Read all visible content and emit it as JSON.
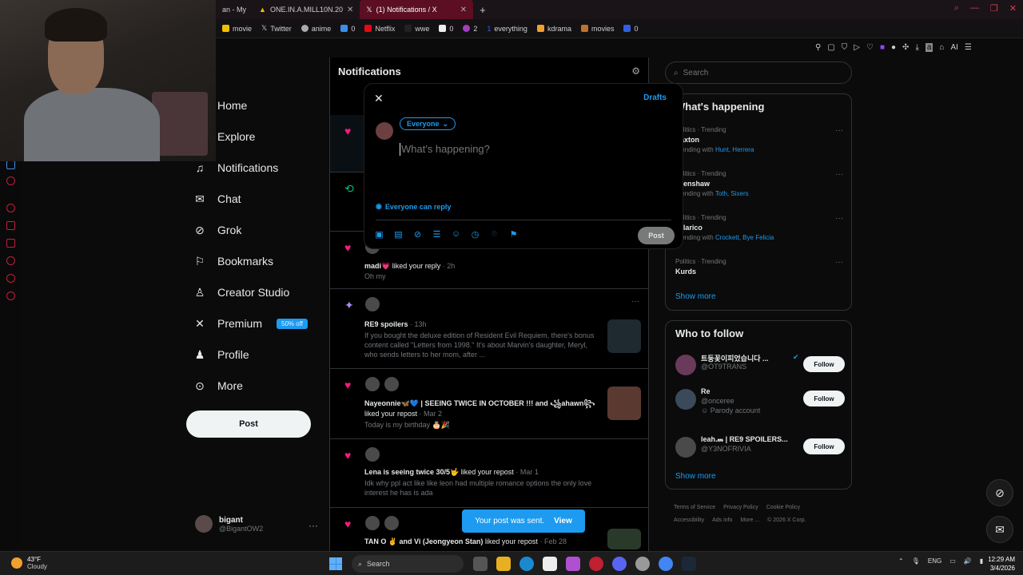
{
  "browser": {
    "tabs": [
      {
        "label": "an - My",
        "active": false
      },
      {
        "label": "ONE.IN.A.MILL10N.20",
        "active": false
      },
      {
        "label": "(1) Notifications / X",
        "active": true
      }
    ],
    "new_tab": "+",
    "bookmarks": [
      {
        "label": "movie",
        "color": "#f0c000"
      },
      {
        "label": "Twitter",
        "color": "#ffffff"
      },
      {
        "label": "anime",
        "color": "#cccccc"
      },
      {
        "label": "0",
        "color": "#3a8ee8"
      },
      {
        "label": "Netflix",
        "color": "#e50914"
      },
      {
        "label": "wwe",
        "color": "#222222"
      },
      {
        "label": "0",
        "color": "#eeeeee"
      },
      {
        "label": "2",
        "color": "#a040c0"
      },
      {
        "label": "everything",
        "color": "#3060e0"
      },
      {
        "label": "kdrama",
        "color": "#f0a030"
      },
      {
        "label": "movies",
        "color": "#c07030"
      },
      {
        "label": "0",
        "color": "#3060e0"
      }
    ],
    "ai_label": "AI"
  },
  "nav": {
    "items": [
      {
        "label": "Home",
        "icon": "home-icon",
        "glyph": "⌂"
      },
      {
        "label": "Explore",
        "icon": "search-icon",
        "glyph": "⌕"
      },
      {
        "label": "Notifications",
        "icon": "bell-icon",
        "glyph": "🔔"
      },
      {
        "label": "Chat",
        "icon": "mail-icon",
        "glyph": "✉"
      },
      {
        "label": "Grok",
        "icon": "grok-icon",
        "glyph": "⊘"
      },
      {
        "label": "Bookmarks",
        "icon": "bookmark-icon",
        "glyph": "⚑"
      },
      {
        "label": "Creator Studio",
        "icon": "creator-icon",
        "glyph": "♙"
      },
      {
        "label": "Premium",
        "icon": "x-logo-icon",
        "glyph": "𝕏"
      },
      {
        "label": "Profile",
        "icon": "person-icon",
        "glyph": "☺"
      },
      {
        "label": "More",
        "icon": "more-icon",
        "glyph": "⋯"
      }
    ],
    "premium_badge": "50% off",
    "post_label": "Post",
    "account": {
      "name": "bigant",
      "handle": "@BigantOW2",
      "more": "···"
    }
  },
  "main": {
    "title": "Notifications",
    "notifications": [
      {
        "type": "like",
        "text_bold": "madi💗",
        "text": " liked your reply",
        "time": "· 2h",
        "sub": "Oh my"
      },
      {
        "type": "spark",
        "text_bold": "RE9 spoilers",
        "text": "",
        "time": "· 13h",
        "sub": "If you bought the deluxe edition of Resident Evil Requiem, there's bonus content called \"Letters from 1998.\" It's about Marvin's daughter, Meryl, who sends letters to her mom, after ..."
      },
      {
        "type": "like",
        "text_bold": "Nayeonnie🦋💙 | SEEING TWICE IN OCTOBER !!! and ꧁ahawn꧂",
        "text": " liked your repost",
        "time": "· Mar 2",
        "sub": "Today is my birthday 🎂🎉"
      },
      {
        "type": "like",
        "text_bold": "Lena is seeing twice 30/5🤟",
        "text": " liked your repost",
        "time": "· Mar 1",
        "sub": "Idk why ppl act like like leon had multiple romance options the only love interest he has is ada"
      },
      {
        "type": "like",
        "text_bold": "TAN O ✌ and Vi (Jeongyeon Stan)",
        "text": " liked your repost",
        "time": "· Feb 28",
        "sub": ""
      }
    ]
  },
  "compose": {
    "close": "✕",
    "drafts": "Drafts",
    "audience": "Everyone",
    "placeholder": "What's happening?",
    "reply_setting": "Everyone can reply",
    "post_label": "Post",
    "tools": [
      "media-icon",
      "gif-icon",
      "grok-icon",
      "poll-icon",
      "emoji-icon",
      "schedule-icon",
      "location-icon",
      "flag-icon"
    ]
  },
  "right": {
    "search_placeholder": "Search",
    "happening_title": "What's happening",
    "trends": [
      {
        "meta": "Politics · Trending",
        "name": "Paxton",
        "with_label": "Trending with ",
        "with": "Hunt, Herrera"
      },
      {
        "meta": "Politics · Trending",
        "name": "Crenshaw",
        "with_label": "Trending with ",
        "with": "Toth, Sixers"
      },
      {
        "meta": "Politics · Trending",
        "name": "Talarico",
        "with_label": "Trending with ",
        "with": "Crockett, Bye Felicia"
      },
      {
        "meta": "Politics · Trending",
        "name": "Kurds",
        "with_label": "",
        "with": ""
      }
    ],
    "show_more": "Show more",
    "wtf_title": "Who to follow",
    "follows": [
      {
        "name": "트둥꽃이피었습니다 ...",
        "handle": "@OT9TRANS",
        "extra": "",
        "verified": true
      },
      {
        "name": "Re",
        "handle": "@onceree",
        "extra": "Parody account",
        "verified": false
      },
      {
        "name": "leah.𝓂 | RE9 SPOILERS...",
        "handle": "@Y3NOFRIVIA",
        "extra": "",
        "verified": false
      }
    ],
    "follow_label": "Follow",
    "footer": [
      "Terms of Service",
      "Privacy Policy",
      "Cookie Policy",
      "Accessibility",
      "Ads info",
      "More ...",
      "© 2026 X Corp."
    ]
  },
  "toast": {
    "text": "Your post was sent.",
    "action": "View"
  },
  "taskbar": {
    "weather_temp": "43°F",
    "weather_desc": "Cloudy",
    "search": "Search",
    "lang": "ENG",
    "time": "12:29 AM",
    "date": "3/4/2026"
  }
}
